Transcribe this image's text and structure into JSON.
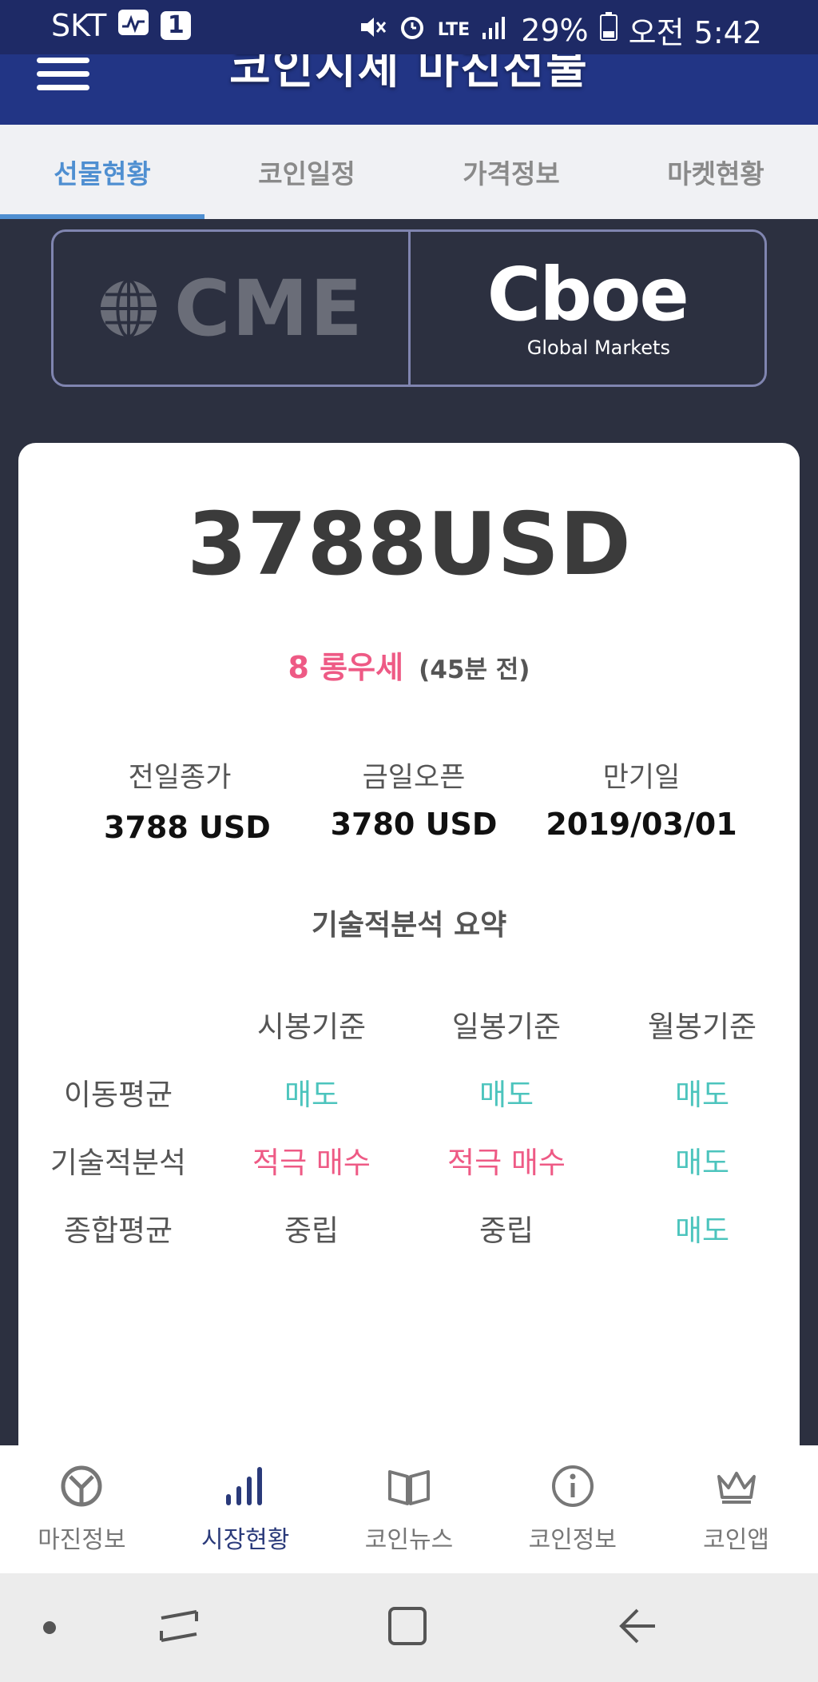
{
  "status_bar": {
    "carrier": "SKT",
    "badge": "1",
    "network": "LTE",
    "battery": "29%",
    "time": "오전 5:42"
  },
  "header": {
    "title": "코인시세 마진선물"
  },
  "tabs": [
    {
      "label": "선물현황",
      "active": true
    },
    {
      "label": "코인일정",
      "active": false
    },
    {
      "label": "가격정보",
      "active": false
    },
    {
      "label": "마켓현황",
      "active": false
    }
  ],
  "exchanges": {
    "cme": {
      "name": "CME"
    },
    "cboe": {
      "name": "Cboe",
      "sub": "Global Markets"
    }
  },
  "futures": {
    "price": "3788USD",
    "change": "8 롱우세",
    "change_time": "(45분 전)",
    "stats": [
      {
        "label": "전일종가",
        "value": "3788 USD"
      },
      {
        "label": "금일오픈",
        "value": "3780 USD"
      },
      {
        "label": "만기일",
        "value": "2019/03/01"
      }
    ]
  },
  "technical": {
    "title": "기술적분석 요약",
    "columns": [
      "시봉기준",
      "일봉기준",
      "월봉기준"
    ],
    "rows": [
      {
        "label": "이동평균",
        "values": [
          "매도",
          "매도",
          "매도"
        ],
        "types": [
          "sell",
          "sell",
          "sell"
        ]
      },
      {
        "label": "기술적분석",
        "values": [
          "적극 매수",
          "적극 매수",
          "매도"
        ],
        "types": [
          "buy",
          "buy",
          "sell"
        ]
      },
      {
        "label": "종합평균",
        "values": [
          "중립",
          "중립",
          "매도"
        ],
        "types": [
          "neutral",
          "neutral",
          "sell"
        ]
      }
    ]
  },
  "bottom_nav": [
    {
      "label": "마진정보",
      "icon": "margin-icon",
      "active": false
    },
    {
      "label": "시장현황",
      "icon": "chart-bars-icon",
      "active": true
    },
    {
      "label": "코인뉴스",
      "icon": "book-icon",
      "active": false
    },
    {
      "label": "코인정보",
      "icon": "info-icon",
      "active": false
    },
    {
      "label": "코인앱",
      "icon": "crown-icon",
      "active": false
    }
  ],
  "colors": {
    "accent_blue": "#4f8fd1",
    "header_blue": "#223585",
    "sell_teal": "#4cc4bd",
    "buy_pink": "#ee5a85"
  }
}
